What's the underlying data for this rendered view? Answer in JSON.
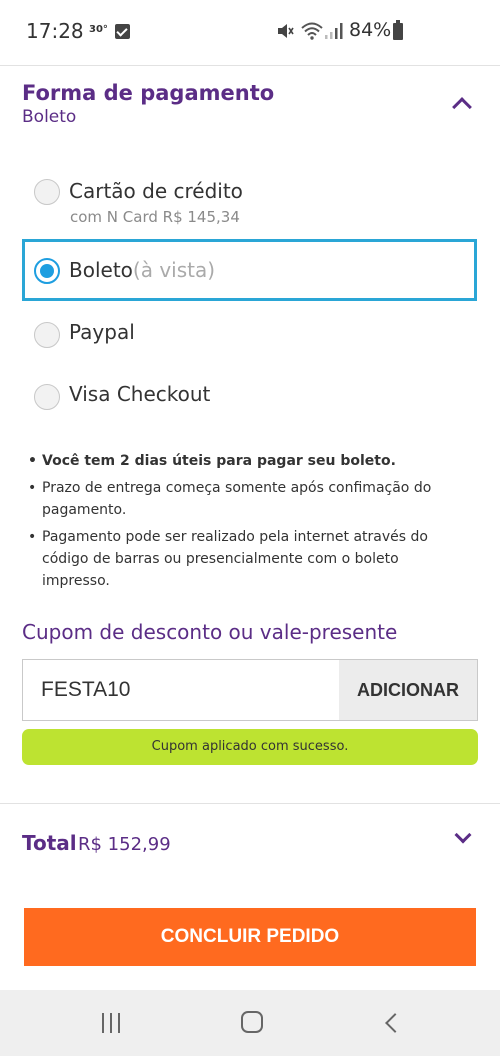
{
  "status_bar": {
    "time": "17:28",
    "temperature": "30°",
    "battery": "84%"
  },
  "payment": {
    "title": "Forma de pagamento",
    "selected": "Boleto",
    "options": [
      {
        "label": "Cartão de crédito",
        "sublabel": "com N Card R$ 145,34",
        "selected": false
      },
      {
        "label": "Boleto",
        "hint": "(à vista)",
        "selected": true
      },
      {
        "label": "Paypal",
        "selected": false
      },
      {
        "label": "Visa Checkout",
        "selected": false
      }
    ],
    "notes": [
      "Você tem 2 dias úteis para pagar seu boleto.",
      "Prazo de entrega começa somente após confimação do pagamento.",
      "Pagamento pode ser realizado pela internet através do código de barras ou presencialmente com o boleto impresso."
    ]
  },
  "coupon": {
    "title": "Cupom de desconto ou vale-presente",
    "value": "FESTA10",
    "button_label": "ADICIONAR",
    "success_message": "Cupom aplicado com sucesso."
  },
  "total": {
    "label": "Total",
    "value": "R$ 152,99"
  },
  "submit": {
    "label": "CONCLUIR PEDIDO"
  },
  "colors": {
    "brand": "#5b2d86",
    "accent": "#ff6a1f",
    "selected": "#1e9ee0",
    "success": "#bde331"
  }
}
